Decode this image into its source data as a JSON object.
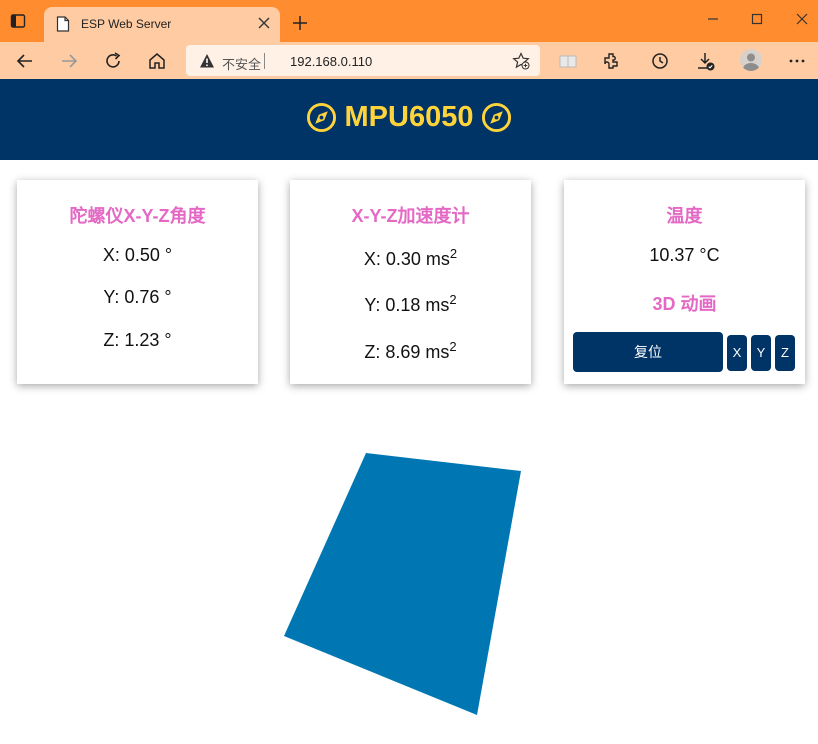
{
  "browser": {
    "tab_title": "ESP Web Server",
    "address_security": "不安全",
    "url": "192.168.0.110"
  },
  "header": {
    "title": "MPU6050"
  },
  "cards": {
    "gyro": {
      "title": "陀螺仪X-Y-Z角度",
      "x": "X: 0.50 °",
      "y": "Y: 0.76 °",
      "z": "Z: 1.23 °"
    },
    "accel": {
      "title": "X-Y-Z加速度计",
      "x": "X: 0.30 ms",
      "y": "Y: 0.18 ms",
      "z": "Z: 8.69 ms",
      "unit_exp": "2"
    },
    "temp": {
      "title": "温度",
      "value": "10.37 °C",
      "animation_title": "3D 动画",
      "reset_label": "复位",
      "x_label": "X",
      "y_label": "Y",
      "z_label": "Z"
    }
  },
  "colors": {
    "header_bg": "#003366",
    "header_text": "#ffd43b",
    "card_title": "#e469c5",
    "cube": "#0077b3",
    "browser_tabbar": "#ff8c2f",
    "browser_toolbar": "#ffcba2"
  },
  "icons": {
    "header": "compass-icon",
    "tab": "page-icon",
    "address": "warning-icon"
  }
}
